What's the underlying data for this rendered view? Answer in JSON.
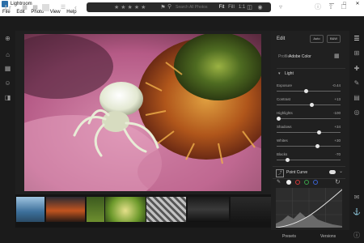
{
  "window": {
    "title": "Lightroom",
    "controls": [
      "minimize-icon",
      "maximize-icon",
      "close-icon"
    ]
  },
  "menu": {
    "items": [
      "File",
      "Edit",
      "Photo",
      "View",
      "Help"
    ]
  },
  "toolbar": {
    "logo": "Lr",
    "search_placeholder": "Search All Photos",
    "icons": [
      "filter-icon",
      "info-icon",
      "share-icon",
      "activity-icon",
      "cloud-icon"
    ]
  },
  "left_rail": {
    "icons": [
      "add-photos-icon",
      "home-icon",
      "photos-icon",
      "people-icon",
      "albums-icon"
    ]
  },
  "edit_panel": {
    "title": "Edit",
    "auto_label": "Auto",
    "bw_label": "B&W",
    "profile_label": "Profile",
    "profile_value": "Adobe Color",
    "light_section": "Light",
    "sliders": [
      {
        "label": "Exposure",
        "value": "-0.44",
        "level": 0.46
      },
      {
        "label": "Contrast",
        "value": "+13",
        "level": 0.56
      },
      {
        "label": "Highlights",
        "value": "-100",
        "level": 0.0
      },
      {
        "label": "Shadows",
        "value": "+34",
        "level": 0.67
      },
      {
        "label": "Whites",
        "value": "+30",
        "level": 0.65
      },
      {
        "label": "Blacks",
        "value": "-70",
        "level": 0.15
      }
    ],
    "point_curve_label": "Point Curve"
  },
  "bottom_bar": {
    "fit_label": "Fit",
    "fill_label": "Fill",
    "ratio_label": "1:1",
    "presets_label": "Presets",
    "versions_label": "Versions",
    "star_rating": "★★★★★"
  },
  "colors": {
    "accent": "#2b6ea8",
    "panel_bg": "#202020",
    "app_bg": "#141414"
  }
}
